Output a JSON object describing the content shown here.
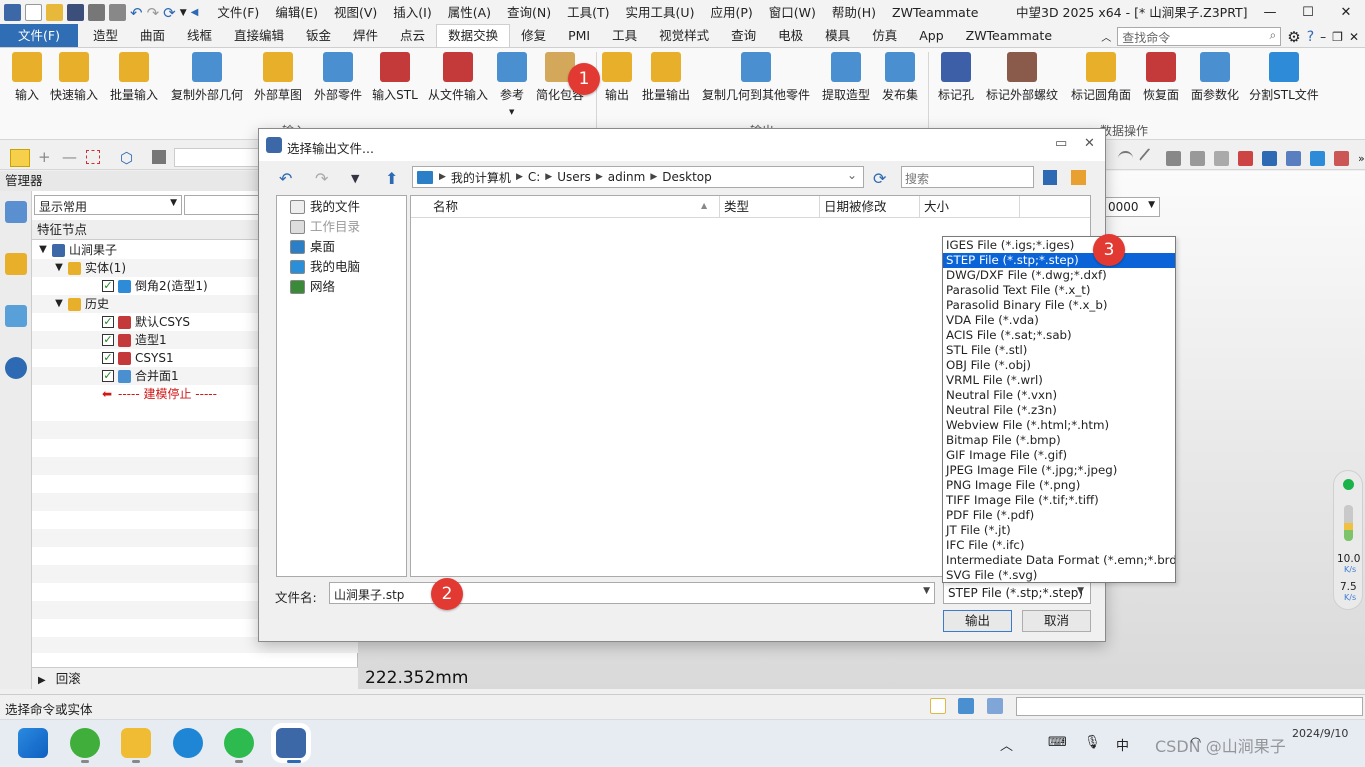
{
  "app": {
    "window_title": "中望3D 2025 x64 - [* 山涧果子.Z3PRT]",
    "menus": [
      "文件(F)",
      "编辑(E)",
      "视图(V)",
      "插入(I)",
      "属性(A)",
      "查询(N)",
      "工具(T)",
      "实用工具(U)",
      "应用(P)",
      "窗口(W)",
      "帮助(H)",
      "ZWTeammate"
    ]
  },
  "ribbon": {
    "tabs": [
      "文件(F)",
      "造型",
      "曲面",
      "线框",
      "直接编辑",
      "钣金",
      "焊件",
      "点云",
      "数据交换",
      "修复",
      "PMI",
      "工具",
      "视觉样式",
      "查询",
      "电极",
      "模具",
      "仿真",
      "App",
      "ZWTeammate"
    ],
    "active_tab": "数据交换",
    "search_placeholder": "查找命令",
    "input_buttons": [
      "输入",
      "快速输入",
      "批量输入",
      "复制外部几何",
      "外部草图",
      "外部零件",
      "输入STL",
      "从文件输入",
      "参考",
      "简化包容"
    ],
    "output_buttons": [
      "输出",
      "批量输出",
      "复制几何到其他零件",
      "提取造型",
      "发布集"
    ],
    "data_buttons": [
      "标记孔",
      "标记外部螺纹",
      "标记圆角面",
      "恢复面",
      "面参数化",
      "分割STL文件"
    ],
    "group_input": "输入",
    "group_output": "输出",
    "group_data": "数据操作"
  },
  "manager": {
    "title": "管理器",
    "filter": "显示常用",
    "header": "特征节点",
    "tree": [
      {
        "label": "山涧果子",
        "level": 0,
        "arrow": "▼",
        "check": false
      },
      {
        "label": "实体(1)",
        "level": 1,
        "arrow": "▼",
        "check": false
      },
      {
        "label": "倒角2(造型1)",
        "level": 2,
        "arrow": "",
        "check": true
      },
      {
        "label": "历史",
        "level": 1,
        "arrow": "▼",
        "check": false
      },
      {
        "label": "默认CSYS",
        "level": 2,
        "arrow": "",
        "check": true
      },
      {
        "label": "造型1",
        "level": 2,
        "arrow": "",
        "check": true
      },
      {
        "label": "CSYS1",
        "level": 2,
        "arrow": "",
        "check": true
      },
      {
        "label": "合并面1",
        "level": 2,
        "arrow": "",
        "check": true
      },
      {
        "label": "----- 建模停止 -----",
        "level": 2,
        "arrow": "",
        "check": false,
        "stop": true
      }
    ],
    "footer": "回滚"
  },
  "viewport": {
    "measurement": "222.352mm",
    "combo_value": "0000",
    "perf_value1": "10.0",
    "perf_unit1": "K/s",
    "perf_value2": "7.5",
    "perf_unit2": "K/s"
  },
  "status": {
    "message": "选择命令或实体"
  },
  "dialog": {
    "title": "选择输出文件...",
    "path": [
      "我的计算机",
      "C:",
      "Users",
      "adinm",
      "Desktop"
    ],
    "search_placeholder": "搜索",
    "places": [
      {
        "label": "我的文件",
        "dim": false
      },
      {
        "label": "工作目录",
        "dim": true
      },
      {
        "label": "桌面",
        "dim": false
      },
      {
        "label": "我的电脑",
        "dim": false
      },
      {
        "label": "网络",
        "dim": false
      }
    ],
    "columns": [
      "名称",
      "类型",
      "日期被修改",
      "大小"
    ],
    "filename_label": "文件名:",
    "filename_value": "山涧果子.stp",
    "filetype_value": "STEP File (*.stp;*.step)",
    "ok_label": "输出",
    "cancel_label": "取消"
  },
  "file_types": [
    "IGES File (*.igs;*.iges)",
    "STEP File (*.stp;*.step)",
    "DWG/DXF File (*.dwg;*.dxf)",
    "Parasolid Text File (*.x_t)",
    "Parasolid Binary File (*.x_b)",
    "VDA File (*.vda)",
    "ACIS File (*.sat;*.sab)",
    "STL File (*.stl)",
    "OBJ File (*.obj)",
    "VRML File (*.wrl)",
    "Neutral File (*.vxn)",
    "Neutral File (*.z3n)",
    "Webview File (*.html;*.htm)",
    "Bitmap File (*.bmp)",
    "GIF Image File (*.gif)",
    "JPEG Image File (*.jpg;*.jpeg)",
    "PNG Image File (*.png)",
    "TIFF Image File (*.tif;*.tiff)",
    "PDF File (*.pdf)",
    "JT File (*.jt)",
    "IFC File (*.ifc)",
    "Intermediate Data Format (*.emn;*.brd)",
    "SVG File (*.svg)"
  ],
  "selected_file_type_index": 1,
  "badges": [
    "1",
    "2",
    "3"
  ],
  "taskbar": {
    "time": "",
    "date": "2024/9/10",
    "watermark": "CSDN @山涧果子",
    "ime": "中"
  },
  "colors": {
    "accent": "#2f6db5",
    "badge": "#e23a32",
    "selection": "#0a64d8"
  }
}
